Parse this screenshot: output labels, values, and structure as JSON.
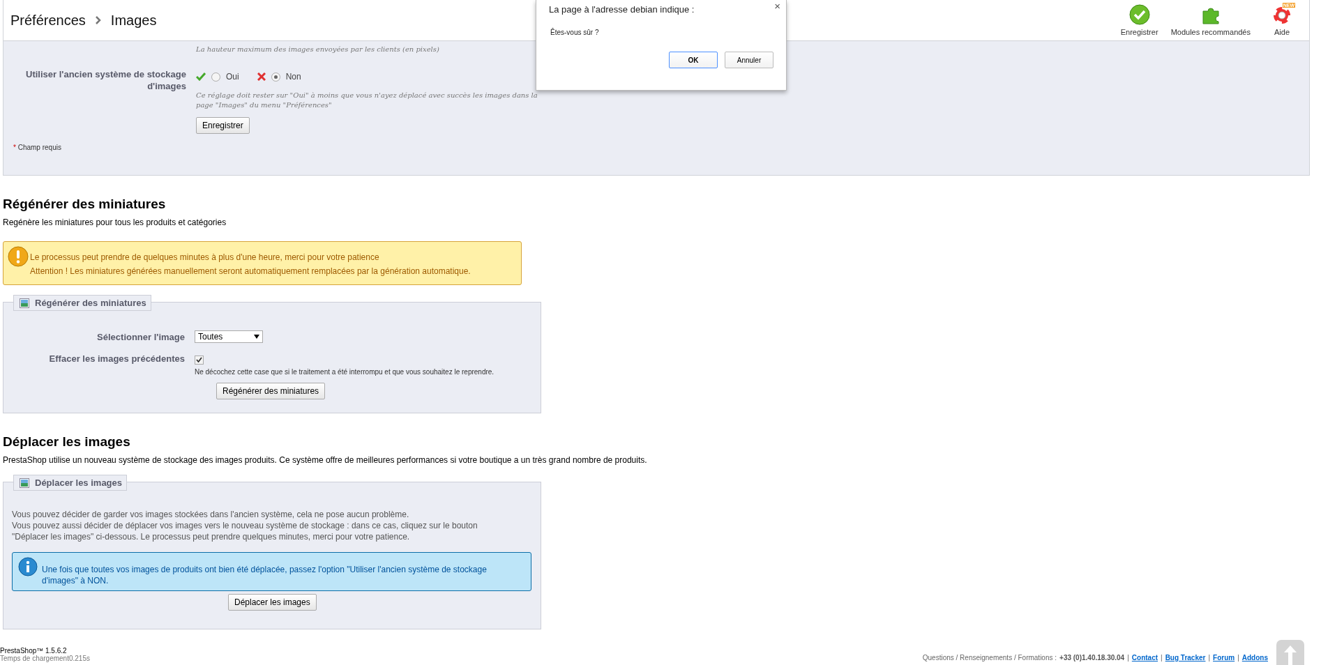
{
  "breadcrumb": {
    "section": "Préférences",
    "page": "Images"
  },
  "toolbar": [
    {
      "label": "Enregistrer",
      "kind": "save"
    },
    {
      "label": "Modules recommandés",
      "kind": "modules"
    },
    {
      "label": "Aide",
      "kind": "help",
      "badge": "NEW"
    }
  ],
  "settings_form": {
    "top_hint": "La hauteur maximum des images envoyées par les clients (en pixels)",
    "field": {
      "label": "Utiliser l'ancien système de stockage d'images",
      "options": [
        {
          "label": "Oui",
          "kind": "yes",
          "selected": false
        },
        {
          "label": "Non",
          "kind": "no",
          "selected": true
        }
      ],
      "hint": "Ce réglage doit rester sur \"Oui\" à moins que vous n'ayez déplacé avec succès les images dans la page \"Images\" du menu \"Préférences\""
    },
    "save_button": "Enregistrer",
    "required_note": {
      "mark": "*",
      "text": "Champ requis"
    }
  },
  "regenerate": {
    "title": "Régénérer des miniatures",
    "description": "Regénère les miniatures pour tous les produits et catégories",
    "warning": [
      "Le processus peut prendre de quelques minutes à plus d'une heure, merci pour votre patience",
      "Attention ! Les miniatures générées manuellement seront automatiquement remplacées par la génération automatique."
    ],
    "fieldset": {
      "legend": "Régénérer des miniatures",
      "select": {
        "label": "Sélectionner l'image",
        "value": "Toutes"
      },
      "checkbox": {
        "label": "Effacer les images précédentes",
        "checked": true,
        "hint": "Ne décochez cette case que si le traitement a été interrompu et que vous souhaitez le reprendre."
      },
      "button": "Régénérer des miniatures"
    }
  },
  "move": {
    "title": "Déplacer les images",
    "description": "PrestaShop utilise un nouveau système de stockage des images produits. Ce système offre de meilleures performances si votre boutique a un très grand nombre de produits.",
    "fieldset": {
      "legend": "Déplacer les images",
      "paragraphs": [
        "Vous pouvez décider de garder vos images stockées dans l'ancien système, cela ne pose aucun problème.",
        "Vous pouvez aussi décider de déplacer vos images vers le nouveau système de stockage : dans ce cas, cliquez sur le bouton \"Déplacer les images\" ci-dessous. Le processus peut prendre quelques minutes, merci pour votre patience."
      ],
      "info": "Une fois que toutes vos images de produits ont bien été déplacée, passez l'option \"Utiliser l'ancien système de stockage d'images\" à NON.",
      "button": "Déplacer les images"
    }
  },
  "footer": {
    "version": "PrestaShop™ 1.5.6.2",
    "load_time": "Temps de chargement0.215s",
    "contact_prefix": "Questions / Renseignements / Formations :",
    "phone": "+33 (0)1.40.18.30.04",
    "separator": "|",
    "links": [
      "Contact",
      "Bug Tracker",
      "Forum",
      "Addons"
    ]
  },
  "dialog": {
    "title": "La page à l'adresse debian indique :",
    "close": "×",
    "message": "Êtes-vous sûr ?",
    "buttons": [
      {
        "label": "OK",
        "kind": "primary"
      },
      {
        "label": "Annuler",
        "kind": "secondary"
      }
    ]
  }
}
